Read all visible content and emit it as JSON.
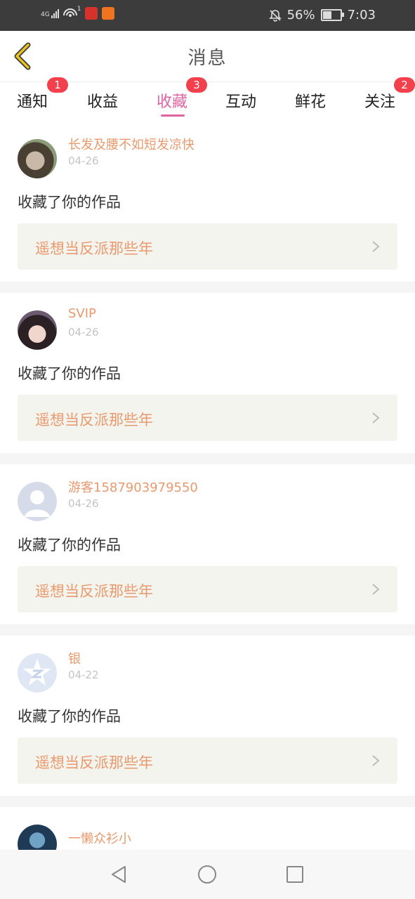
{
  "status_bar": {
    "network": "4G",
    "sim_indicator": "1",
    "battery": "56%",
    "battery_level": 0.56,
    "time": "7:03",
    "icons": [
      "signal-icon",
      "wifi-hotspot-icon",
      "app-icon-red",
      "app-icon-orange",
      "mute-bell-icon",
      "battery-icon"
    ]
  },
  "header": {
    "title": "消息",
    "back_icon": "chevron-left-icon"
  },
  "tabs": [
    {
      "label": "通知",
      "badge": "1"
    },
    {
      "label": "收益",
      "badge": ""
    },
    {
      "label": "收藏",
      "badge": "3",
      "active": true
    },
    {
      "label": "互动",
      "badge": ""
    },
    {
      "label": "鲜花",
      "badge": ""
    },
    {
      "label": "关注",
      "badge": "2"
    }
  ],
  "messages": [
    {
      "username": "长发及腰不如短发凉快",
      "date": "04-26",
      "action": "收藏了你的作品",
      "work_title": "遥想当反派那些年"
    },
    {
      "username": "SVIP",
      "date": "04-26",
      "action": "收藏了你的作品",
      "work_title": "遥想当反派那些年"
    },
    {
      "username": "游客1587903979550",
      "date": "04-26",
      "action": "收藏了你的作品",
      "work_title": "遥想当反派那些年"
    },
    {
      "username": "银",
      "date": "04-22",
      "action": "收藏了你的作品",
      "work_title": "遥想当反派那些年"
    },
    {
      "username": "一懒众衫小",
      "date": "",
      "action": "",
      "work_title": ""
    }
  ],
  "colors": {
    "accent": "#e063a2",
    "username": "#e89a6e",
    "badge": "#f2404d",
    "back_arrow": "#d8b21a",
    "card_bg": "#f4f4ee"
  },
  "nav_bar": {
    "icons": [
      "back-triangle-icon",
      "home-circle-icon",
      "recents-square-icon"
    ]
  }
}
